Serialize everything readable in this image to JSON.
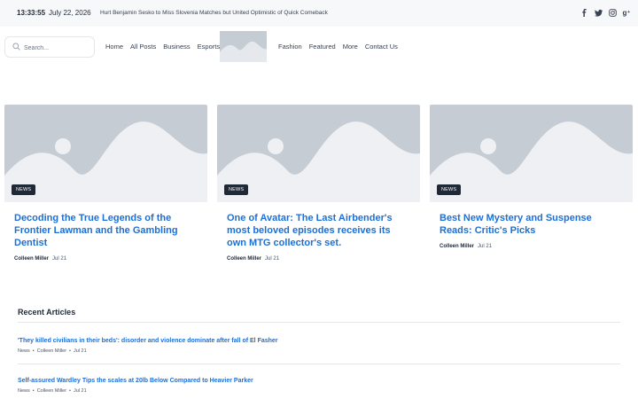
{
  "topbar": {
    "time": "13:33:55",
    "date": "July 22, 2026",
    "ticker": "Hurt Benjamin Sesko to Miss Slovenia Matches but United Optimistic of Quick Comeback",
    "social": [
      "facebook-icon",
      "twitter-icon",
      "instagram-icon",
      "google-plus-icon"
    ]
  },
  "search": {
    "placeholder": "Search..."
  },
  "nav": {
    "left": [
      "Home",
      "All Posts",
      "Business",
      "Esports"
    ],
    "right": [
      "Fashion",
      "Featured",
      "More",
      "Contact Us"
    ]
  },
  "cards": [
    {
      "badge": "NEWS",
      "title": "Decoding the True Legends of the Frontier Lawman and the Gambling Dentist",
      "author": "Colleen Miller",
      "date": "Jul 21"
    },
    {
      "badge": "NEWS",
      "title": "One of Avatar: The Last Airbender's most beloved episodes receives its own MTG collector's set.",
      "author": "Colleen Miller",
      "date": "Jul 21"
    },
    {
      "badge": "NEWS",
      "title": "Best New Mystery and Suspense Reads: Critic's Picks",
      "author": "Colleen Miller",
      "date": "Jul 21"
    }
  ],
  "recent": {
    "heading": "Recent Articles",
    "items": [
      {
        "title": "'They killed civilians in their beds': disorder and violence dominate after fall of El Fasher",
        "category": "News",
        "author": "Colleen Miller",
        "date": "Jul 21"
      },
      {
        "title": "Self-assured Wardley Tips the scales at 20lb Below Compared to Heavier Parker",
        "category": "News",
        "author": "Colleen Miller",
        "date": "Jul 21"
      }
    ]
  },
  "colors": {
    "accent": "#1d6fd6",
    "placeholder": "#c5ccd3",
    "badge": "#1f2937"
  }
}
